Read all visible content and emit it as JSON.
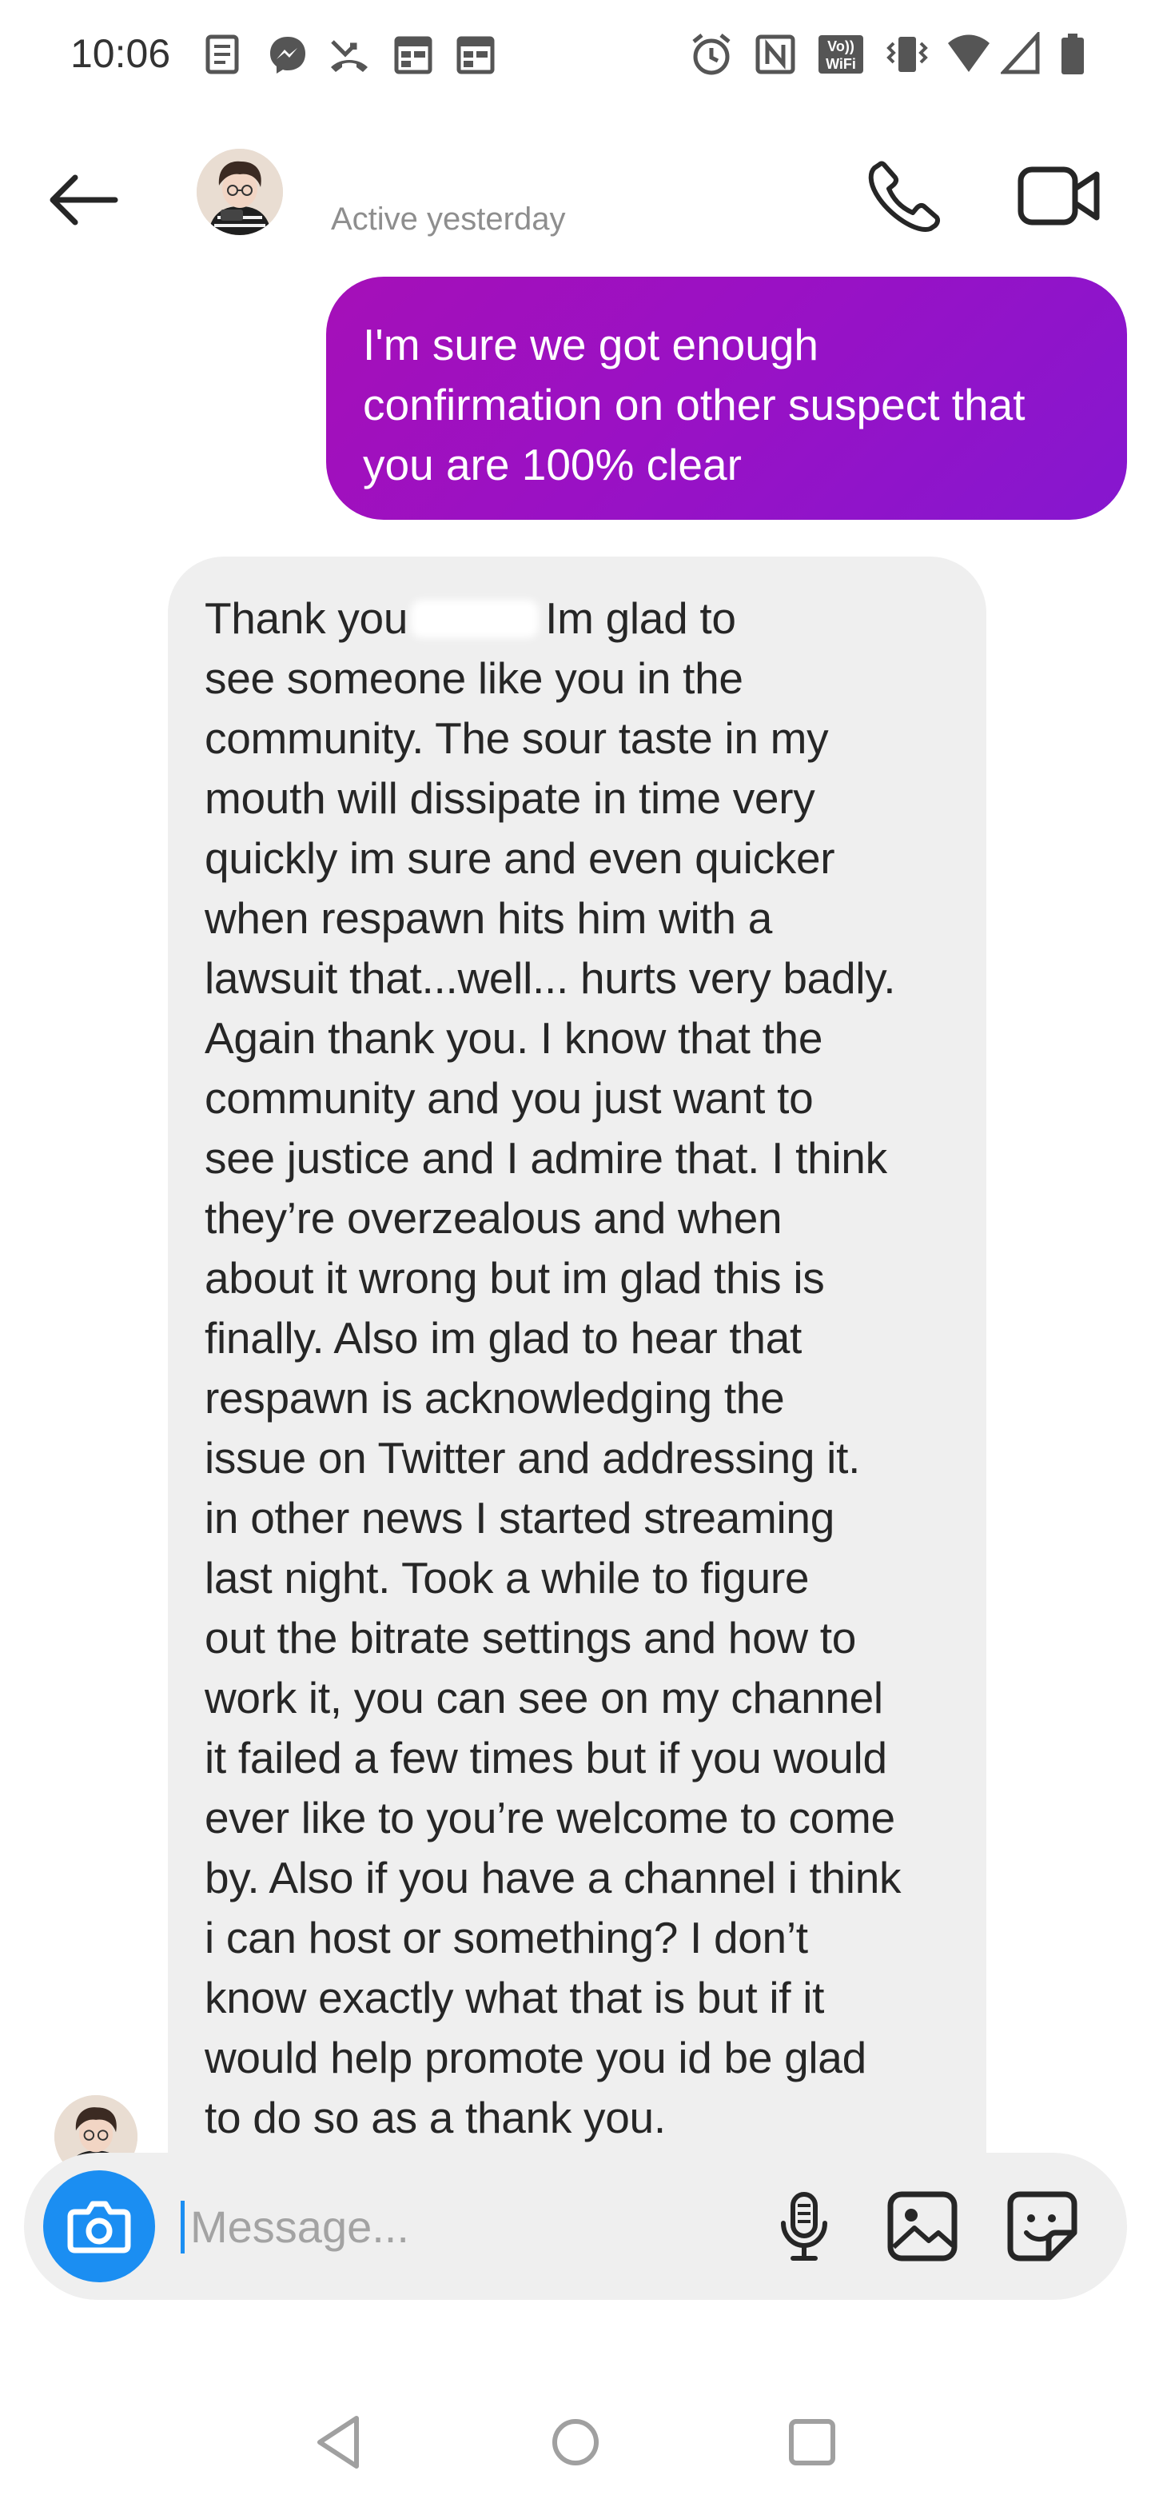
{
  "status_bar": {
    "time": "10:06"
  },
  "header": {
    "active_status": "Active yesterday"
  },
  "messages": [
    {
      "sender": "me",
      "lines": [
        "I'm sure we got enough",
        "confirmation on other suspect that",
        "you are 100% clear"
      ]
    },
    {
      "sender": "them",
      "first_line_start": "Thank you",
      "first_line_end": "Im glad to",
      "lines": [
        "see someone like you in the",
        "community. The sour taste in my",
        "mouth will dissipate in time very",
        "quickly im sure and even quicker",
        "when respawn hits him with a",
        "lawsuit that...well... hurts very badly.",
        "Again thank you. I know that the",
        "community and you just want to",
        "see justice and I admire that. I think",
        "they’re overzealous and when",
        "about it wrong but im glad this is",
        "finally. Also im glad to hear that",
        "respawn is acknowledging the",
        "issue on Twitter and addressing it.",
        "in other news I started streaming",
        "last night. Took a while to figure",
        "out the bitrate settings and how to",
        "work it, you can see on my channel",
        "it failed a few times but if you would",
        "ever like to you’re welcome to come",
        "by. Also if you have a channel i think",
        "i can host or something? I don’t",
        "know exactly what that is but if it",
        "would help promote you id be glad",
        "to do so as a thank you."
      ]
    }
  ],
  "composer": {
    "placeholder": "Message..."
  },
  "colors": {
    "outgoing_bubble": "#9a11c4",
    "incoming_bubble": "#efefef",
    "camera_button": "#1b8ef2"
  },
  "icons": {
    "status_left": [
      "news-icon",
      "messenger-icon",
      "missed-call-icon",
      "calendar-icon",
      "calendar-icon"
    ],
    "status_right": [
      "alarm-icon",
      "nfc-icon",
      "vowifi-icon",
      "vibrate-icon",
      "wifi-icon",
      "signal-icon",
      "battery-icon"
    ]
  }
}
